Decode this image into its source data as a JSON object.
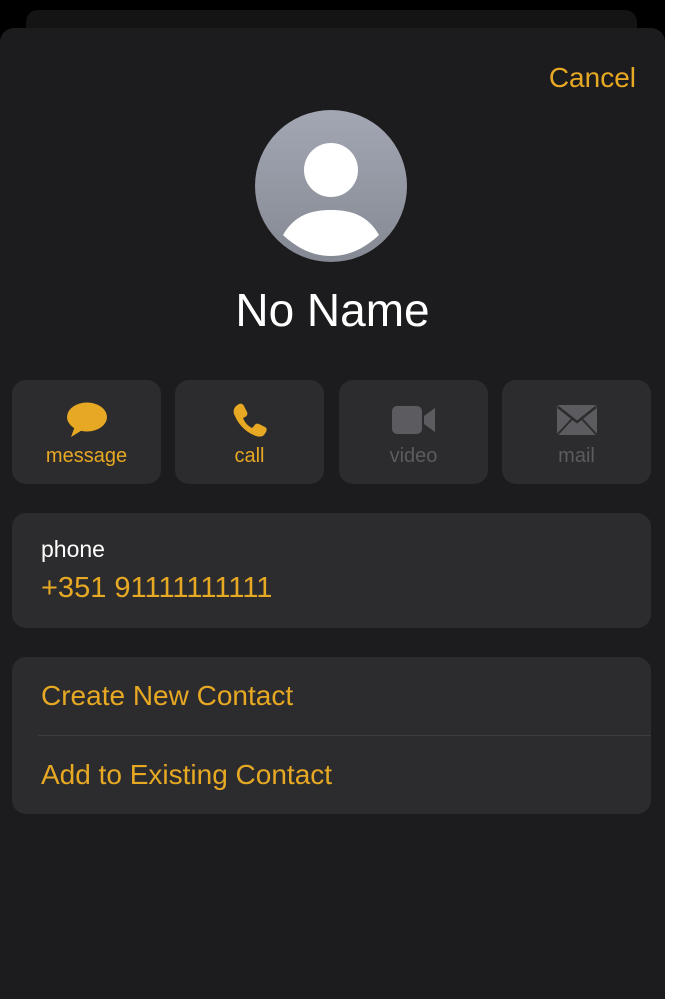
{
  "header": {
    "cancel_label": "Cancel"
  },
  "contact": {
    "avatar_icon": "person-silhouette-icon",
    "name": "No Name"
  },
  "actions": [
    {
      "label": "message",
      "icon": "message-bubble-icon",
      "enabled": true
    },
    {
      "label": "call",
      "icon": "phone-handset-icon",
      "enabled": true
    },
    {
      "label": "video",
      "icon": "video-camera-icon",
      "enabled": false
    },
    {
      "label": "mail",
      "icon": "envelope-icon",
      "enabled": false
    }
  ],
  "phone": {
    "label": "phone",
    "number": "+351 91111111111"
  },
  "options": [
    {
      "label": "Create New Contact"
    },
    {
      "label": "Add to Existing Contact"
    }
  ],
  "colors": {
    "accent": "#e7a823",
    "sheet_background": "#1c1c1e",
    "card_background": "#2c2c2e",
    "disabled": "#5c5c60"
  }
}
